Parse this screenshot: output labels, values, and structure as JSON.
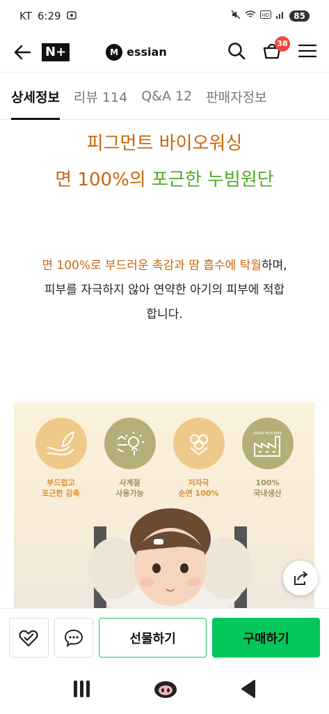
{
  "status": {
    "carrier": "KT",
    "time": "6:29",
    "battery": "85"
  },
  "header": {
    "badge": "N+",
    "brand": "essian",
    "cart_count": "38"
  },
  "tabs": [
    {
      "label": "상세정보"
    },
    {
      "label": "리뷰 114"
    },
    {
      "label": "Q&A 12"
    },
    {
      "label": "판매자정보"
    }
  ],
  "hero": {
    "line1": "피그먼트 바이오워싱",
    "line2_part1": "면 100%의 ",
    "line2_part2": "포근한 누빔원단"
  },
  "description": {
    "highlight": "면 100%로 부드러운 촉감과 땀 흡수에 탁월",
    "rest1": "하며,",
    "line2": "피부를 자극하지 않아 연약한 아기의 피부에 적합",
    "line3": "합니다."
  },
  "features": [
    {
      "label": "부드럽고\n포근한 감촉",
      "icon": "leaf-hand-icon"
    },
    {
      "label": "사계절\n사용가능",
      "icon": "weather-icon"
    },
    {
      "label": "저자극\n순면 100%",
      "icon": "cotton-icon"
    },
    {
      "label": "100%\n국내생산",
      "icon": "factory-icon"
    }
  ],
  "factory_sign": "MADE IN KOREA",
  "actions": {
    "gift": "선물하기",
    "buy": "구매하기"
  },
  "colors": {
    "accent_green": "#03c75a",
    "orange": "#c6670d",
    "green": "#4fa82b",
    "cart_badge": "#f0463c"
  }
}
